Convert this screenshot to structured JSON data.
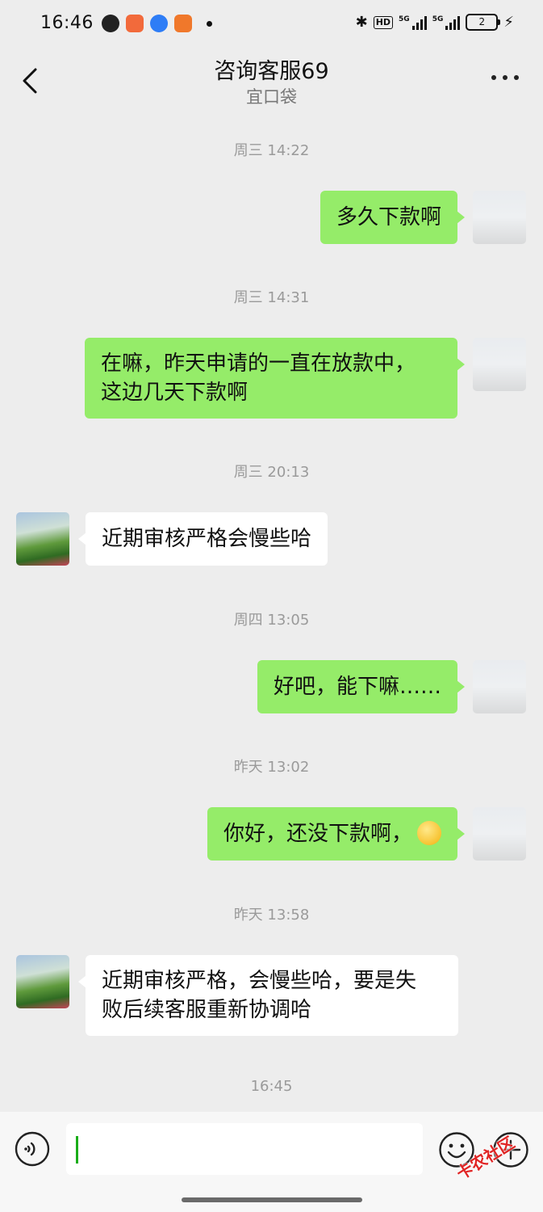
{
  "status_bar": {
    "time": "16:46",
    "battery_level": "2",
    "network_badges": [
      "HD",
      "5G",
      "5G"
    ]
  },
  "header": {
    "title": "咨询客服69",
    "subtitle": "宜口袋"
  },
  "messages": [
    {
      "timestamp": "周三 14:22",
      "sender": "me",
      "text": "多久下款啊"
    },
    {
      "timestamp": "周三 14:31",
      "sender": "me",
      "text": "在嘛，昨天申请的一直在放款中，\n这边几天下款啊"
    },
    {
      "timestamp": "周三 20:13",
      "sender": "other",
      "text": "近期审核严格会慢些哈"
    },
    {
      "timestamp": "周四 13:05",
      "sender": "me",
      "text": "好吧，能下嘛……"
    },
    {
      "timestamp": "昨天 13:02",
      "sender": "me",
      "text": "你好，还没下款啊，",
      "emoji": "smile-emoji"
    },
    {
      "timestamp": "昨天 13:58",
      "sender": "other",
      "text": "近期审核严格，会慢些哈，要是失\n败后续客服重新协调哈"
    }
  ],
  "last_timestamp": "16:45",
  "input": {
    "value": ""
  },
  "watermark": "卡农社区",
  "colors": {
    "background": "#ededed",
    "my_bubble": "#95ec69",
    "other_bubble": "#ffffff"
  }
}
